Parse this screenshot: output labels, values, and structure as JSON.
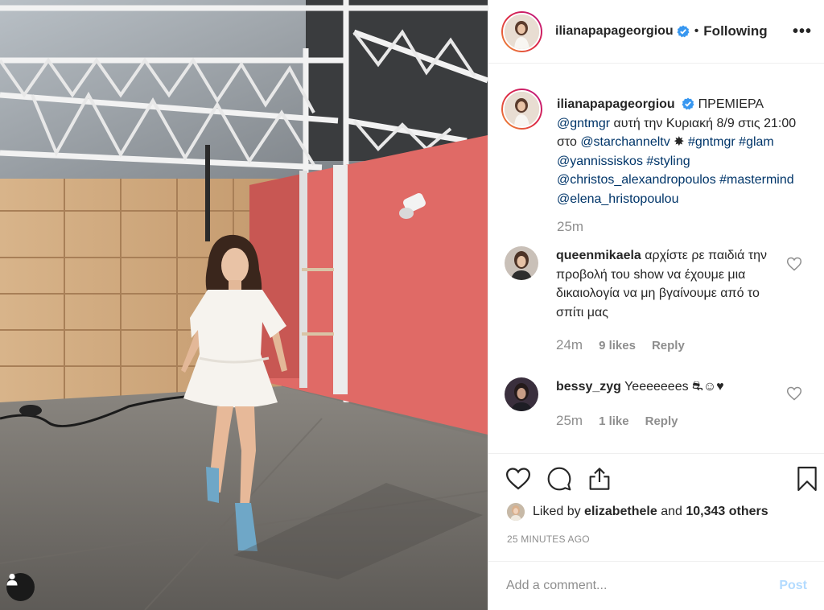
{
  "header": {
    "username": "ilianapapageorgiou",
    "separator": "•",
    "follow_label": "Following",
    "more_label": "•••"
  },
  "caption": {
    "username": "ilianapapageorgiou",
    "segments": [
      {
        "text": "ΠΡΕΜΙΕΡΑ ",
        "link": false
      },
      {
        "text": "@gntmgr",
        "link": true
      },
      {
        "text": " αυτή την Κυριακή 8/9 στις 21:00 στο ",
        "link": false
      },
      {
        "text": "@starchanneltv",
        "link": true
      },
      {
        "text": " ✸ ",
        "link": false
      },
      {
        "text": "#gntmgr",
        "link": true
      },
      {
        "text": " ",
        "link": false
      },
      {
        "text": "#glam",
        "link": true
      },
      {
        "text": " ",
        "link": false
      },
      {
        "text": "@yannissiskos",
        "link": true
      },
      {
        "text": " ",
        "link": false
      },
      {
        "text": "#styling",
        "link": true
      },
      {
        "text": " ",
        "link": false
      },
      {
        "text": "@christos_alexandropoulos",
        "link": true
      },
      {
        "text": " ",
        "link": false
      },
      {
        "text": "#mastermind",
        "link": true
      },
      {
        "text": " ",
        "link": false
      },
      {
        "text": "@elena_hristopoulou",
        "link": true
      }
    ],
    "time": "25m"
  },
  "comments": [
    {
      "username": "queenmikaela",
      "text": "αρχίστε ρε παιδιά την προβολή του show να έχουμε μια δικαιολογία να μη βγαίνουμε από το σπίτι μας",
      "time": "24m",
      "likes": "9 likes",
      "reply": "Reply"
    },
    {
      "username": "bessy_zyg",
      "text": "Yeeeeeees ⛐☺♥",
      "time": "25m",
      "likes": "1 like",
      "reply": "Reply"
    }
  ],
  "likes": {
    "prefix": "Liked by ",
    "user": "elizabethele",
    "middle": " and ",
    "count": "10,343 others"
  },
  "time_ago": "25 MINUTES AGO",
  "add_comment": {
    "placeholder": "Add a comment...",
    "post_label": "Post"
  },
  "colors": {
    "link": "#003569",
    "verified": "#3897f0",
    "muted": "#8e8e8e",
    "post_disabled": "#b3dbff"
  },
  "icons": [
    "verified-badge-icon",
    "more-options-icon",
    "heart-icon",
    "comment-icon",
    "share-icon",
    "bookmark-icon",
    "user-tag-icon"
  ]
}
